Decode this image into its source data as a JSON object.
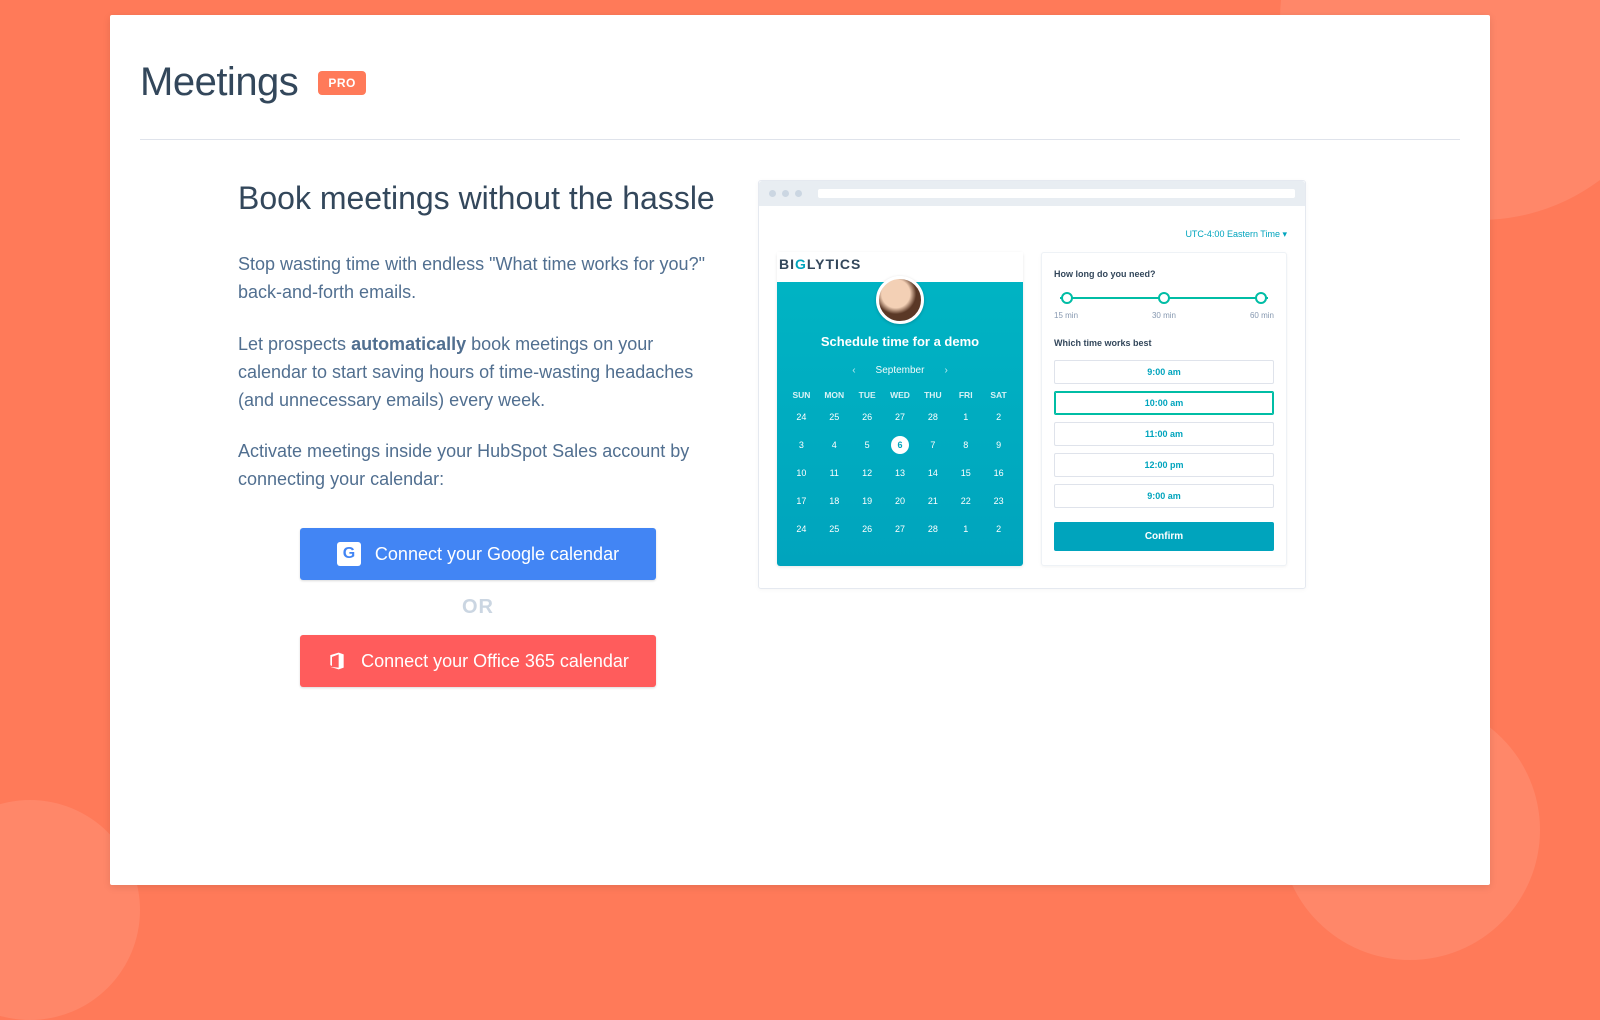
{
  "header": {
    "title": "Meetings",
    "badge": "PRO"
  },
  "hero": {
    "heading": "Book meetings without the hassle",
    "p1": "Stop wasting time with endless \"What time works for you?\" back-and-forth emails.",
    "p2a": "Let prospects ",
    "p2_strong": "automatically",
    "p2b": " book meetings on your calendar to start saving hours of time-wasting headaches (and unnecessary emails) every week.",
    "p3": "Activate meetings inside your HubSpot Sales account by connecting your calendar:"
  },
  "cta": {
    "google": "Connect your Google calendar",
    "or": "OR",
    "office": "Connect your Office 365 calendar"
  },
  "preview": {
    "timezone": "UTC-4:00 Eastern Time ▾",
    "brand_a": "BI",
    "brand_b": "G",
    "brand_c": "LYTICS",
    "cal_title": "Schedule time for a demo",
    "month": "September",
    "dow": [
      "SUN",
      "MON",
      "TUE",
      "WED",
      "THU",
      "FRI",
      "SAT"
    ],
    "dates": [
      [
        "24",
        "25",
        "26",
        "27",
        "28",
        "1",
        "2"
      ],
      [
        "3",
        "4",
        "5",
        "6",
        "7",
        "8",
        "9"
      ],
      [
        "10",
        "11",
        "12",
        "13",
        "14",
        "15",
        "16"
      ],
      [
        "17",
        "18",
        "19",
        "20",
        "21",
        "22",
        "23"
      ],
      [
        "24",
        "25",
        "26",
        "27",
        "28",
        "1",
        "2"
      ]
    ],
    "selected_date": "6",
    "dur_label": "How long do you need?",
    "dur_opts": [
      "15 min",
      "30 min",
      "60 min"
    ],
    "time_label": "Which time works best",
    "slots": [
      "9:00 am",
      "10:00 am",
      "11:00 am",
      "12:00 pm",
      "9:00 am"
    ],
    "selected_slot": "10:00 am",
    "confirm": "Confirm"
  }
}
